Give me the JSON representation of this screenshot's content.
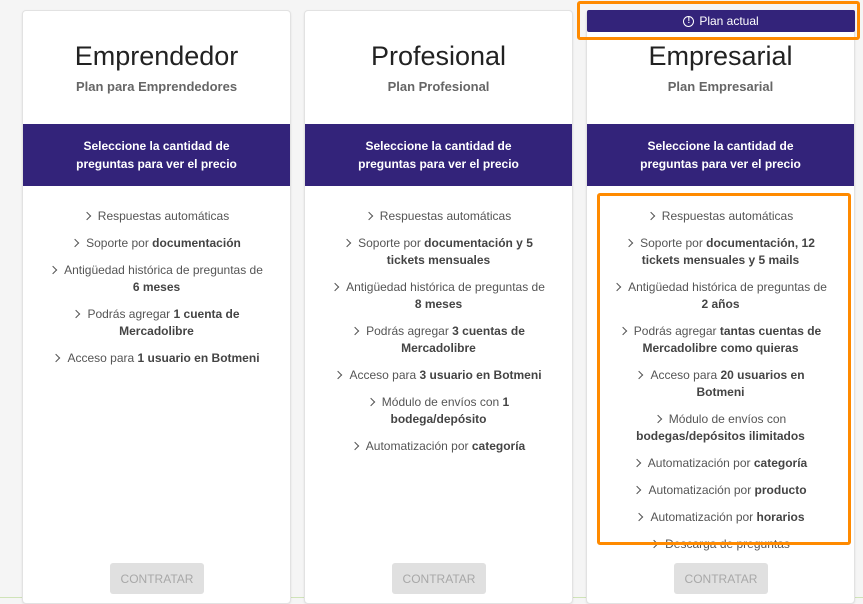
{
  "plans": [
    {
      "title": "Emprendedor",
      "subtitle": "Plan para Emprendedores",
      "price_prompt": "Seleccione la cantidad de preguntas para ver el precio",
      "features": [
        [
          "Respuestas automáticas",
          ""
        ],
        [
          "Soporte por ",
          "documentación"
        ],
        [
          "Antigüedad histórica de preguntas de ",
          "6 meses"
        ],
        [
          "Podrás agregar ",
          "1 cuenta de Mercadolibre"
        ],
        [
          "Acceso para ",
          "1 usuario en Botmeni"
        ]
      ],
      "button": "CONTRATAR"
    },
    {
      "title": "Profesional",
      "subtitle": "Plan Profesional",
      "price_prompt": "Seleccione la cantidad de preguntas para ver el precio",
      "features": [
        [
          "Respuestas automáticas",
          ""
        ],
        [
          "Soporte por ",
          "documentación y 5 tickets mensuales"
        ],
        [
          "Antigüedad histórica de preguntas de ",
          "8 meses"
        ],
        [
          "Podrás agregar ",
          "3 cuentas de Mercadolibre"
        ],
        [
          "Acceso para ",
          "3 usuario en Botmeni"
        ],
        [
          "Módulo de envíos con ",
          "1 bodega/depósito"
        ],
        [
          "Automatización por ",
          "categoría"
        ]
      ],
      "button": "CONTRATAR"
    },
    {
      "title": "Empresarial",
      "subtitle": "Plan Empresarial",
      "price_prompt": "Seleccione la cantidad de preguntas para ver el precio",
      "features": [
        [
          "Respuestas automáticas",
          ""
        ],
        [
          "Soporte por ",
          "documentación, 12 tickets mensuales y 5 mails"
        ],
        [
          "Antigüedad histórica de preguntas de ",
          "2 años"
        ],
        [
          "Podrás agregar ",
          "tantas cuentas de Mercadolibre como quieras"
        ],
        [
          "Acceso para ",
          "20 usuarios en Botmeni"
        ],
        [
          "Módulo de envíos con ",
          "bodegas/depósitos ilimitados"
        ],
        [
          "Automatización por ",
          "categoría"
        ],
        [
          "Automatización por ",
          "producto"
        ],
        [
          "Automatización por ",
          "horarios"
        ],
        [
          "Descarga de preguntas",
          ""
        ]
      ],
      "button": "CONTRATAR"
    }
  ],
  "current_plan_badge": "Plan actual",
  "colors": {
    "band": "#33237a",
    "highlight": "#ff8a00"
  }
}
